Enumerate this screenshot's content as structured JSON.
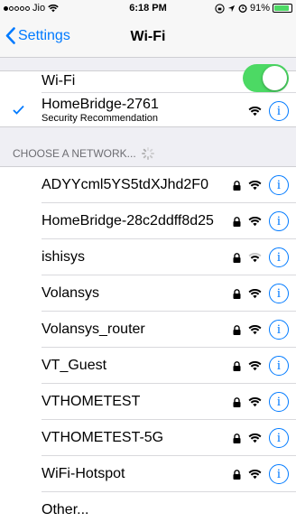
{
  "status_bar": {
    "carrier": "Jio",
    "time": "6:18 PM",
    "battery": "91%"
  },
  "nav": {
    "back_label": "Settings",
    "title": "Wi-Fi"
  },
  "wifi_toggle": {
    "label": "Wi-Fi",
    "on": true
  },
  "connected": {
    "name": "HomeBridge-2761",
    "subtitle": "Security Recommendation"
  },
  "section_header": "CHOOSE A NETWORK...",
  "networks": [
    {
      "name": "ADYYcml5YS5tdXJhd2F0"
    },
    {
      "name": "HomeBridge-28c2ddff8d25"
    },
    {
      "name": "ishisys"
    },
    {
      "name": "Volansys"
    },
    {
      "name": "Volansys_router"
    },
    {
      "name": "VT_Guest"
    },
    {
      "name": "VTHOMETEST"
    },
    {
      "name": "VTHOMETEST-5G"
    },
    {
      "name": "WiFi-Hotspot"
    }
  ],
  "other_label": "Other...",
  "colors": {
    "accent": "#007aff",
    "toggle_on": "#4cd964",
    "background": "#efeff4"
  }
}
